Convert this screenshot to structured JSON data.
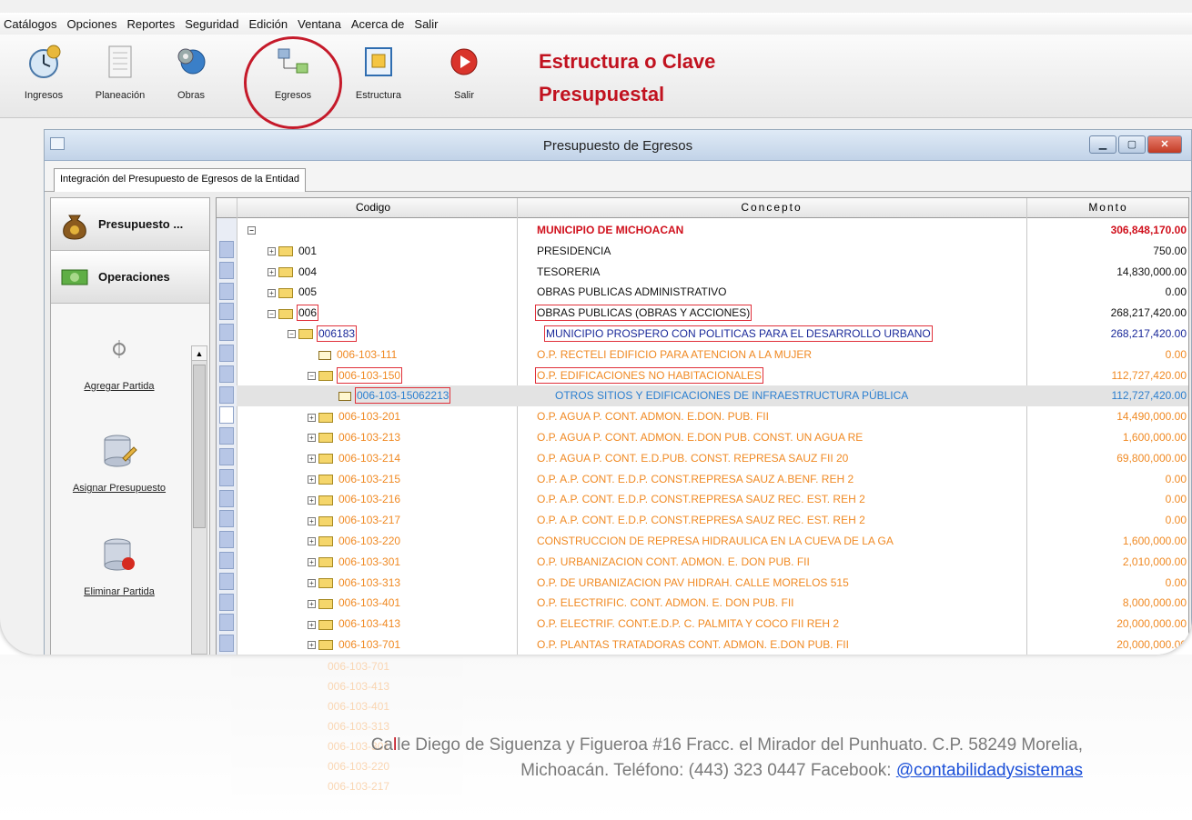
{
  "menu": [
    "Catálogos",
    "Opciones",
    "Reportes",
    "Seguridad",
    "Edición",
    "Ventana",
    "Acerca de",
    "Salir"
  ],
  "toolbar": {
    "buttons": [
      {
        "label": "Ingresos",
        "icon": "coins-clock-icon"
      },
      {
        "label": "Planeación",
        "icon": "document-icon"
      },
      {
        "label": "Obras",
        "icon": "gear-globe-icon"
      },
      {
        "label": "Egresos",
        "icon": "org-chart-icon"
      },
      {
        "label": "Estructura",
        "icon": "structure-icon"
      },
      {
        "label": "Salir",
        "icon": "exit-icon"
      }
    ],
    "banner_line1": "Estructura o Clave",
    "banner_line2": "Presupuestal"
  },
  "window": {
    "title": "Presupuesto de Egresos",
    "tab": "Integración del Presupuesto de Egresos de la Entidad",
    "nav": {
      "headers": [
        "Presupuesto ...",
        "Operaciones"
      ],
      "actions": [
        "Agregar Partida",
        "Asignar Presupuesto",
        "Eliminar Partida"
      ]
    },
    "columns": {
      "code": "Codigo",
      "concept": "Concepto",
      "amount": "Monto"
    }
  },
  "rows": [
    {
      "level": 0,
      "code": "",
      "concept": "MUNICIPIO DE MICHOACAN",
      "amount": "306,848,170.00",
      "style": "red"
    },
    {
      "level": 1,
      "code": "001",
      "concept": "PRESIDENCIA",
      "amount": "750.00",
      "style": "black"
    },
    {
      "level": 1,
      "code": "004",
      "concept": "TESORERIA",
      "amount": "14,830,000.00",
      "style": "black"
    },
    {
      "level": 1,
      "code": "005",
      "concept": "OBRAS PUBLICAS ADMINISTRATIVO",
      "amount": "0.00",
      "style": "black"
    },
    {
      "level": 1,
      "code": "006",
      "concept": "OBRAS PUBLICAS (OBRAS Y ACCIONES)",
      "amount": "268,217,420.00",
      "style": "black"
    },
    {
      "level": 2,
      "code": "006183",
      "concept": "MUNICIPIO PROSPERO CON POLITICAS PARA EL DESARROLLO URBANO",
      "amount": "268,217,420.00",
      "style": "blue"
    },
    {
      "level": 3,
      "code": "006-103-111",
      "concept": "O.P. RECTELI EDIFICIO PARA ATENCION A LA MUJER",
      "amount": "0.00",
      "style": "orange"
    },
    {
      "level": 3,
      "code": "006-103-150",
      "concept": "O.P. EDIFICACIONES NO HABITACIONALES",
      "amount": "112,727,420.00",
      "style": "orange"
    },
    {
      "level": 4,
      "code": "006-103-15062213",
      "concept": "OTROS SITIOS Y EDIFICACIONES DE INFRAESTRUCTURA PÚBLICA",
      "amount": "112,727,420.00",
      "style": "cyan"
    },
    {
      "level": 3,
      "code": "006-103-201",
      "concept": "O.P. AGUA P. CONT. ADMON. E.DON. PUB. FII",
      "amount": "14,490,000.00",
      "style": "orange"
    },
    {
      "level": 3,
      "code": "006-103-213",
      "concept": "O.P. AGUA P. CONT. ADMON. E.DON PUB. CONST. UN AGUA RE",
      "amount": "1,600,000.00",
      "style": "orange"
    },
    {
      "level": 3,
      "code": "006-103-214",
      "concept": "O.P. AGUA P. CONT. E.D.PUB. CONST. REPRESA SAUZ FII 20",
      "amount": "69,800,000.00",
      "style": "orange"
    },
    {
      "level": 3,
      "code": "006-103-215",
      "concept": "O.P. A.P. CONT. E.D.P. CONST.REPRESA SAUZ A.BENF. REH 2",
      "amount": "0.00",
      "style": "orange"
    },
    {
      "level": 3,
      "code": "006-103-216",
      "concept": "O.P. A.P. CONT. E.D.P. CONST.REPRESA SAUZ REC. EST. REH 2",
      "amount": "0.00",
      "style": "orange"
    },
    {
      "level": 3,
      "code": "006-103-217",
      "concept": "O.P. A.P. CONT. E.D.P. CONST.REPRESA SAUZ REC. EST. REH 2",
      "amount": "0.00",
      "style": "orange"
    },
    {
      "level": 3,
      "code": "006-103-220",
      "concept": "CONSTRUCCION DE REPRESA HIDRAULICA EN LA CUEVA DE LA GA",
      "amount": "1,600,000.00",
      "style": "orange"
    },
    {
      "level": 3,
      "code": "006-103-301",
      "concept": "O.P. URBANIZACION CONT. ADMON. E. DON PUB. FII",
      "amount": "2,010,000.00",
      "style": "orange"
    },
    {
      "level": 3,
      "code": "006-103-313",
      "concept": "O.P. DE URBANIZACION PAV HIDRAH. CALLE MORELOS 515",
      "amount": "0.00",
      "style": "orange"
    },
    {
      "level": 3,
      "code": "006-103-401",
      "concept": "O.P. ELECTRIFIC. CONT. ADMON. E. DON PUB. FII",
      "amount": "8,000,000.00",
      "style": "orange"
    },
    {
      "level": 3,
      "code": "006-103-413",
      "concept": "O.P. ELECTRIF. CONT.E.D.P. C. PALMITA Y COCO FII REH 2",
      "amount": "20,000,000.00",
      "style": "orange"
    },
    {
      "level": 3,
      "code": "006-103-701",
      "concept": "O.P. PLANTAS TRATADORAS CONT. ADMON. E.DON PUB. FII",
      "amount": "20,000,000.00",
      "style": "orange"
    }
  ],
  "footer": {
    "line1_initial": "Ca",
    "line1_accent": "l",
    "line1_rest": "le Diego de Siguenza y Figueroa #16 Fracc. el Mirador del Punhuato. C.P. 58249 Morelia,",
    "line2": "Michoacán. Teléfono: (443) 323 0447 Facebook:",
    "link": "@contabilidadysistemas"
  },
  "colors": {
    "accent_red": "#c1121f",
    "orange": "#f08a24",
    "blue": "#1b2a9a",
    "selected_blue": "#2b7fd0"
  }
}
